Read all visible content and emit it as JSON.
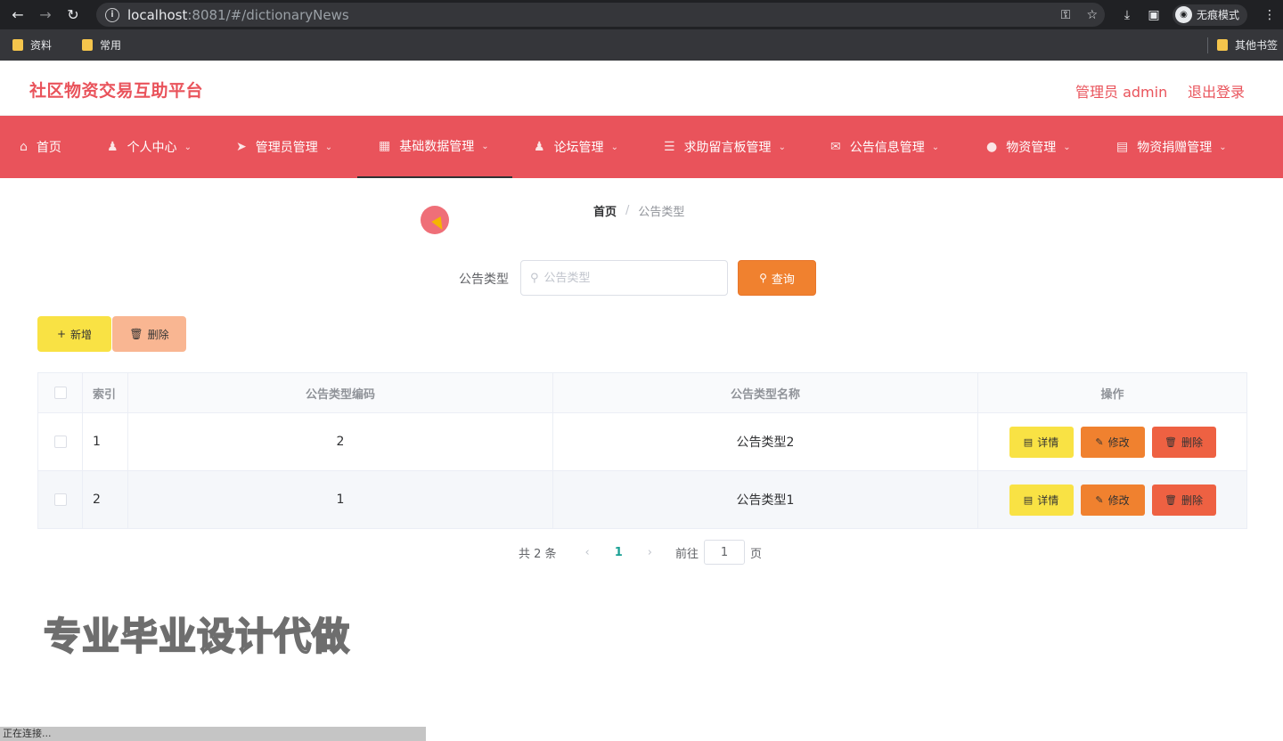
{
  "browser": {
    "url_host": "localhost",
    "url_rest": ":8081/#/dictionaryNews",
    "incognito_label": "无痕模式",
    "bookmarks": [
      "资料",
      "常用"
    ],
    "other_bookmarks": "其他书签"
  },
  "header": {
    "title": "社区物资交易互助平台",
    "admin": "管理员 admin",
    "logout": "退出登录"
  },
  "menu": {
    "items": [
      {
        "label": "首页",
        "icon": "home-icon"
      },
      {
        "label": "个人中心",
        "icon": "user-icon"
      },
      {
        "label": "管理员管理",
        "icon": "send-icon"
      },
      {
        "label": "基础数据管理",
        "icon": "grid-icon"
      },
      {
        "label": "论坛管理",
        "icon": "user-icon"
      },
      {
        "label": "求助留言板管理",
        "icon": "list-icon"
      },
      {
        "label": "公告信息管理",
        "icon": "folder-icon"
      },
      {
        "label": "物资管理",
        "icon": "location-icon"
      },
      {
        "label": "物资捐赠管理",
        "icon": "image-icon"
      }
    ],
    "active_index": 3
  },
  "breadcrumb": {
    "home": "首页",
    "separator": "/",
    "current": "公告类型"
  },
  "search": {
    "label": "公告类型",
    "placeholder": "公告类型",
    "value": "",
    "button": "查询"
  },
  "actions": {
    "add": "新增",
    "delete": "删除"
  },
  "table": {
    "headers": [
      "索引",
      "公告类型编码",
      "公告类型名称",
      "操作"
    ],
    "rows": [
      {
        "index": "1",
        "code": "2",
        "name": "公告类型2"
      },
      {
        "index": "2",
        "code": "1",
        "name": "公告类型1"
      }
    ],
    "ops": {
      "detail": "详情",
      "edit": "修改",
      "delete": "删除"
    }
  },
  "pagination": {
    "total": "共 2 条",
    "current": "1",
    "goto_prefix": "前往",
    "goto_value": "1",
    "goto_suffix": "页"
  },
  "watermark": "专业毕业设计代做",
  "status": "正在连接...",
  "colors": {
    "brand": "#e9535b",
    "query": "#f0812f",
    "add": "#f9e244",
    "delete_light": "#f9b692",
    "delete": "#ee6142"
  }
}
